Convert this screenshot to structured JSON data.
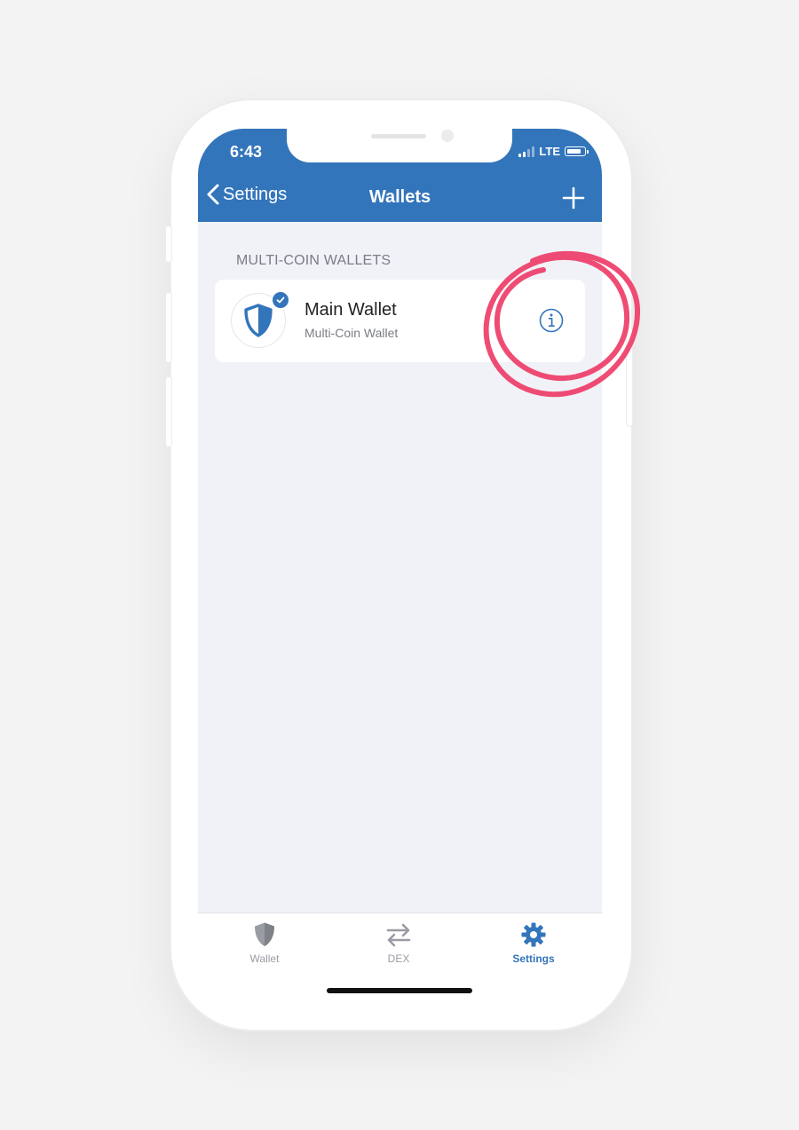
{
  "status_bar": {
    "time": "6:43",
    "network": "LTE"
  },
  "nav": {
    "back_label": "Settings",
    "title": "Wallets"
  },
  "section": {
    "label": "MULTI-COIN WALLETS"
  },
  "wallets": [
    {
      "name": "Main Wallet",
      "type": "Multi-Coin Wallet",
      "selected": true
    }
  ],
  "tabs": [
    {
      "label": "Wallet",
      "icon": "shield-icon",
      "active": false
    },
    {
      "label": "DEX",
      "icon": "swap-arrows-icon",
      "active": false
    },
    {
      "label": "Settings",
      "icon": "gear-icon",
      "active": true
    }
  ],
  "colors": {
    "brand_blue": "#3375bb",
    "background": "#f1f2f7",
    "annotation_pink": "#ee3d68",
    "inactive_gray": "#9a9ca3"
  }
}
